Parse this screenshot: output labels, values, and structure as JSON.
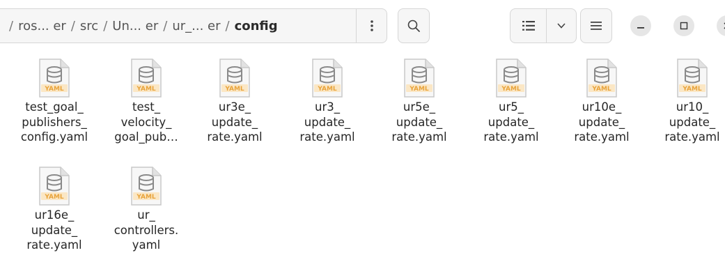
{
  "breadcrumb": [
    {
      "label": "ros... er",
      "current": false
    },
    {
      "label": "src",
      "current": false
    },
    {
      "label": "Un... er",
      "current": false
    },
    {
      "label": "ur_... er",
      "current": false
    },
    {
      "label": "config",
      "current": true
    }
  ],
  "separator": "/",
  "toolbar": {
    "path_menu_icon": "vertical-dots-icon",
    "search_icon": "search-icon",
    "view_list_icon": "list-view-icon",
    "view_options_icon": "chevron-down-icon",
    "main_menu_icon": "hamburger-menu-icon"
  },
  "window_controls": {
    "minimize_icon": "minimize-icon",
    "maximize_icon": "maximize-icon",
    "close_icon": "close-icon"
  },
  "file_icon_label": "YAML",
  "files": [
    {
      "label": "test_goal_\npublishers_\nconfig.yaml"
    },
    {
      "label": "test_\nvelocity_\ngoal_pub…"
    },
    {
      "label": "ur3e_\nupdate_\nrate.yaml"
    },
    {
      "label": "ur3_\nupdate_\nrate.yaml"
    },
    {
      "label": "ur5e_\nupdate_\nrate.yaml"
    },
    {
      "label": "ur5_\nupdate_\nrate.yaml"
    },
    {
      "label": "ur10e_\nupdate_\nrate.yaml"
    },
    {
      "label": "ur10_\nupdate_\nrate.yaml"
    },
    {
      "label": "ur16e_\nupdate_\nrate.yaml"
    },
    {
      "label": "ur_\ncontrollers.\nyaml"
    }
  ],
  "colors": {
    "yaml_badge": "#e8a33a",
    "page_fold": "#cfcfcf",
    "db_icon": "#8a8a8a"
  }
}
